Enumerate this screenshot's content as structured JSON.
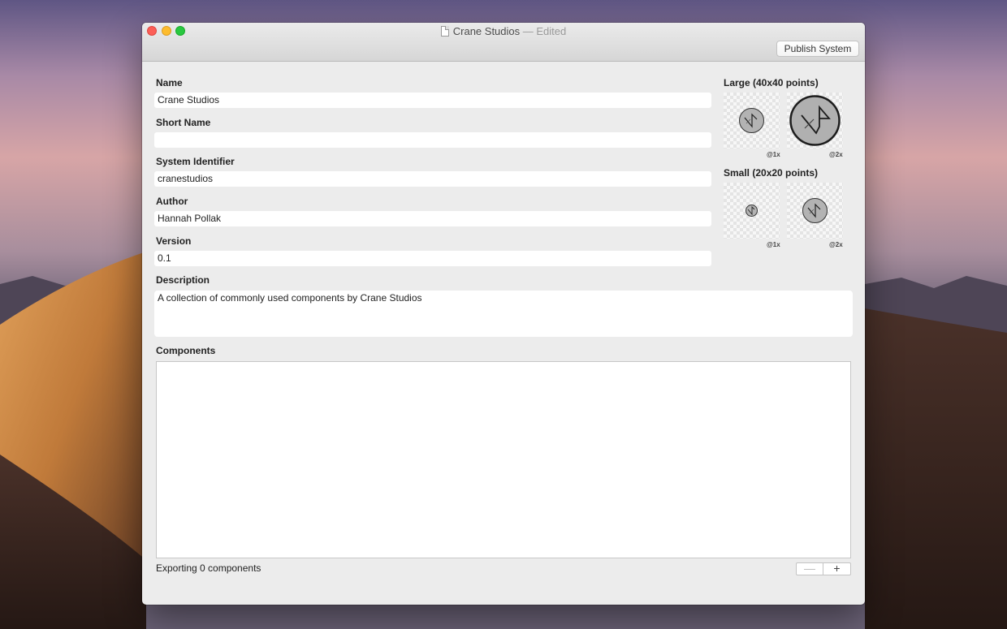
{
  "window": {
    "title": "Crane Studios",
    "title_suffix": "— Edited"
  },
  "toolbar": {
    "publish_label": "Publish System"
  },
  "form": {
    "name_label": "Name",
    "name_value": "Crane Studios",
    "short_name_label": "Short Name",
    "short_name_value": "",
    "identifier_label": "System Identifier",
    "identifier_value": "cranestudios",
    "author_label": "Author",
    "author_value": "Hannah Pollak",
    "version_label": "Version",
    "version_value": "0.1",
    "description_label": "Description",
    "description_value": "A collection of commonly used components by Crane Studios"
  },
  "icons": {
    "large_label": "Large (40x40 points)",
    "small_label": "Small (20x20 points)",
    "scale_1x": "@1x",
    "scale_2x": "@2x",
    "icon_name": "crane-logo-icon"
  },
  "components": {
    "label": "Components",
    "status": "Exporting 0 components",
    "remove_symbol": "—",
    "add_symbol": "+"
  },
  "colors": {
    "close": "#fc5f57",
    "minimize": "#fdbc2e",
    "maximize": "#29c840"
  }
}
